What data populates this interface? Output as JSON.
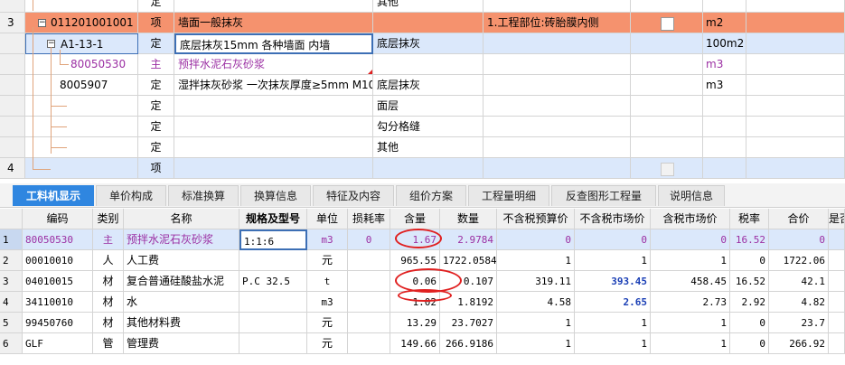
{
  "top_rows": [
    {
      "idx": "",
      "code": "",
      "type": "定",
      "name": "",
      "feature": "其他",
      "desc": "",
      "unit": ""
    },
    {
      "idx": "3",
      "code": "011201001001",
      "type": "项",
      "name": "墙面一般抹灰",
      "feature": "",
      "desc": "1.工程部位:砖胎膜内侧",
      "unit": "m2"
    },
    {
      "idx": "",
      "code": "A1-13-1",
      "type": "定",
      "name": "底层抹灰15mm 各种墙面 内墙",
      "feature": "底层抹灰",
      "desc": "",
      "unit": "100m2"
    },
    {
      "idx": "",
      "code": "80050530",
      "type": "主",
      "name": "预拌水泥石灰砂浆",
      "feature": "",
      "desc": "",
      "unit": "m3"
    },
    {
      "idx": "",
      "code": "8005907",
      "type": "定",
      "name": "湿拌抹灰砂浆 一次抹灰厚度≥5mm M10",
      "feature": "底层抹灰",
      "desc": "",
      "unit": "m3"
    },
    {
      "idx": "",
      "code": "",
      "type": "定",
      "name": "",
      "feature": "面层",
      "desc": "",
      "unit": ""
    },
    {
      "idx": "",
      "code": "",
      "type": "定",
      "name": "",
      "feature": "勾分格缝",
      "desc": "",
      "unit": ""
    },
    {
      "idx": "",
      "code": "",
      "type": "定",
      "name": "",
      "feature": "其他",
      "desc": "",
      "unit": ""
    },
    {
      "idx": "4",
      "code": "",
      "type": "项",
      "name": "",
      "feature": "",
      "desc": "",
      "unit": ""
    }
  ],
  "tabs": [
    "工料机显示",
    "单价构成",
    "标准换算",
    "换算信息",
    "特征及内容",
    "组价方案",
    "工程量明细",
    "反查图形工程量",
    "说明信息"
  ],
  "columns": {
    "code": "编码",
    "cat": "类别",
    "name": "名称",
    "spec": "规格及型号",
    "unit": "单位",
    "loss": "损耗率",
    "qty": "含量",
    "amount": "数量",
    "budget": "不含税预算价",
    "market": "不含税市场价",
    "tmarket": "含税市场价",
    "tax": "税率",
    "total": "合价",
    "more": "是否"
  },
  "rows": [
    {
      "idx": "1",
      "code": "80050530",
      "cat": "主",
      "name": "预拌水泥石灰砂浆",
      "spec": "1:1:6",
      "unit": "m3",
      "loss": "0",
      "qty": "1.67",
      "amount": "2.9784",
      "budget": "0",
      "market": "0",
      "tmarket": "0",
      "tax": "16.52",
      "total": "0"
    },
    {
      "idx": "2",
      "code": "00010010",
      "cat": "人",
      "name": "人工费",
      "spec": "",
      "unit": "元",
      "loss": "",
      "qty": "965.55",
      "amount": "1722.0584",
      "budget": "1",
      "market": "1",
      "tmarket": "1",
      "tax": "0",
      "total": "1722.06"
    },
    {
      "idx": "3",
      "code": "04010015",
      "cat": "材",
      "name": "复合普通硅酸盐水泥",
      "spec": "P.C 32.5",
      "unit": "t",
      "loss": "",
      "qty": "0.06",
      "amount": "0.107",
      "budget": "319.11",
      "market": "393.45",
      "tmarket": "458.45",
      "tax": "16.52",
      "total": "42.1"
    },
    {
      "idx": "4",
      "code": "34110010",
      "cat": "材",
      "name": "水",
      "spec": "",
      "unit": "m3",
      "loss": "",
      "qty": "1.02",
      "amount": "1.8192",
      "budget": "4.58",
      "market": "2.65",
      "tmarket": "2.73",
      "tax": "2.92",
      "total": "4.82"
    },
    {
      "idx": "5",
      "code": "99450760",
      "cat": "材",
      "name": "其他材料费",
      "spec": "",
      "unit": "元",
      "loss": "",
      "qty": "13.29",
      "amount": "23.7027",
      "budget": "1",
      "market": "1",
      "tmarket": "1",
      "tax": "0",
      "total": "23.7"
    },
    {
      "idx": "6",
      "code": "GLF",
      "cat": "管",
      "name": "管理费",
      "spec": "",
      "unit": "元",
      "loss": "",
      "qty": "149.66",
      "amount": "266.9186",
      "budget": "1",
      "market": "1",
      "tmarket": "1",
      "tax": "0",
      "total": "266.92"
    }
  ]
}
